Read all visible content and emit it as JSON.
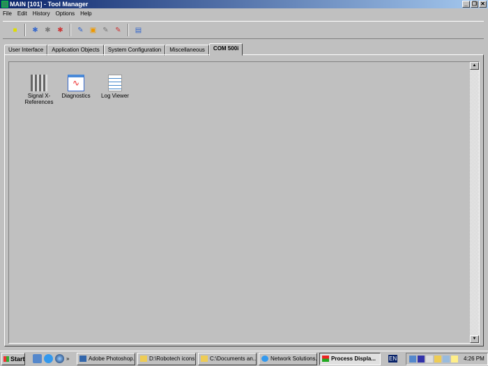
{
  "window": {
    "title": "MAIN [101] - Tool Manager",
    "min": "_",
    "restore": "❐",
    "close": "✕"
  },
  "menu": [
    "File",
    "Edit",
    "History",
    "Options",
    "Help"
  ],
  "toolbar": [
    "open-icon",
    "add-tool-icon",
    "tool-properties-icon",
    "delete-tool-icon",
    "add-object-icon",
    "monitor-icon",
    "object-properties-icon",
    "delete-object-icon",
    "info-icon"
  ],
  "tabs": [
    "User Interface",
    "Application Objects",
    "System Configuration",
    "Miscellaneous",
    "COM 500i"
  ],
  "active_tab": "COM 500i",
  "tools": [
    {
      "label": "Signal X-References"
    },
    {
      "label": "Diagnostics"
    },
    {
      "label": "Log Viewer"
    }
  ],
  "taskbar": {
    "start": "Start",
    "chevron": "»",
    "tasks": [
      "Adobe Photoshop...",
      "D:\\Robotech icons",
      "C:\\Documents an...",
      "Network Solutions...",
      "Process Displa..."
    ],
    "lang": "EN",
    "clock": "4:26 PM"
  }
}
